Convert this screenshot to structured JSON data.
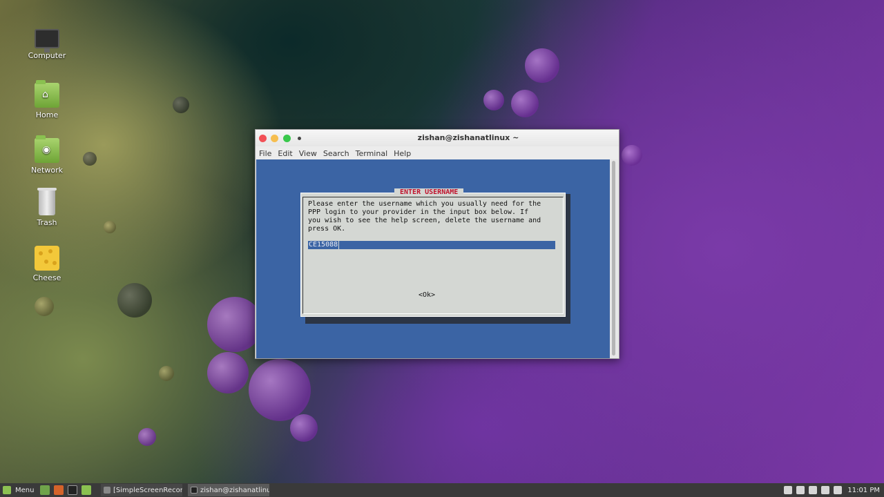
{
  "desktop": {
    "icons": [
      {
        "label": "Computer"
      },
      {
        "label": "Home"
      },
      {
        "label": "Network"
      },
      {
        "label": "Trash"
      },
      {
        "label": "Cheese"
      }
    ]
  },
  "window": {
    "title": "zishan@zishanatlinux ~",
    "menu": [
      "File",
      "Edit",
      "View",
      "Search",
      "Terminal",
      "Help"
    ]
  },
  "dialog": {
    "title": "ENTER USERNAME",
    "lines": [
      "Please enter the username which you usually need for the",
      "PPP login to your provider in the input box below. If",
      "you wish to see the help screen, delete the username and",
      "press OK."
    ],
    "input_value": "CE15088",
    "ok_label": "<Ok>"
  },
  "taskbar": {
    "menu_label": "Menu",
    "tasks": [
      {
        "label": "[SimpleScreenRecor..."
      },
      {
        "label": "zishan@zishanatlinu..."
      }
    ],
    "clock": "11:01 PM"
  },
  "colors": {
    "terminal_bg": "#3b64a4",
    "dialog_bg": "#d4d7d3",
    "dialog_title": "#c0122c"
  }
}
